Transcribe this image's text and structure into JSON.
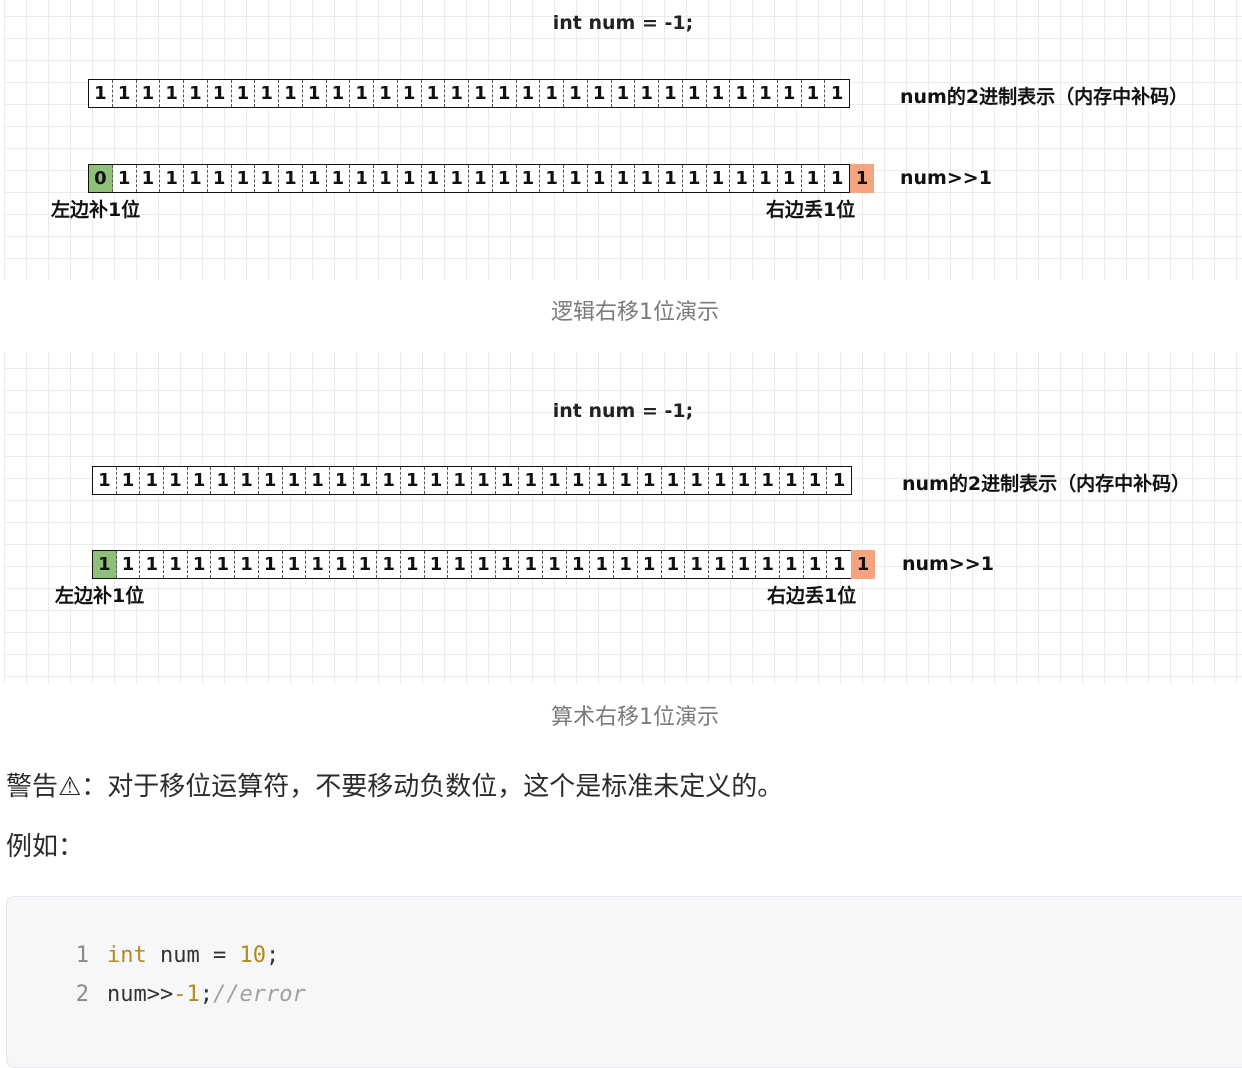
{
  "diagram1": {
    "title": "int num = -1;",
    "row1_bits": [
      "1",
      "1",
      "1",
      "1",
      "1",
      "1",
      "1",
      "1",
      "1",
      "1",
      "1",
      "1",
      "1",
      "1",
      "1",
      "1",
      "1",
      "1",
      "1",
      "1",
      "1",
      "1",
      "1",
      "1",
      "1",
      "1",
      "1",
      "1",
      "1",
      "1",
      "1",
      "1"
    ],
    "row1_label": "num的2进制表示（内存中补码）",
    "row2_bits": [
      "0",
      "1",
      "1",
      "1",
      "1",
      "1",
      "1",
      "1",
      "1",
      "1",
      "1",
      "1",
      "1",
      "1",
      "1",
      "1",
      "1",
      "1",
      "1",
      "1",
      "1",
      "1",
      "1",
      "1",
      "1",
      "1",
      "1",
      "1",
      "1",
      "1",
      "1",
      "1"
    ],
    "row2_out_bit": "1",
    "row2_label": "num>>1",
    "left_fill_label": "左边补1位",
    "right_drop_label": "右边丢1位",
    "fill_color": "#8fc07a",
    "drop_color": "#f4a57f"
  },
  "caption1": "逻辑右移1位演示",
  "diagram2": {
    "title": "int num = -1;",
    "row1_bits": [
      "1",
      "1",
      "1",
      "1",
      "1",
      "1",
      "1",
      "1",
      "1",
      "1",
      "1",
      "1",
      "1",
      "1",
      "1",
      "1",
      "1",
      "1",
      "1",
      "1",
      "1",
      "1",
      "1",
      "1",
      "1",
      "1",
      "1",
      "1",
      "1",
      "1",
      "1",
      "1"
    ],
    "row1_label": "num的2进制表示（内存中补码）",
    "row2_bits": [
      "1",
      "1",
      "1",
      "1",
      "1",
      "1",
      "1",
      "1",
      "1",
      "1",
      "1",
      "1",
      "1",
      "1",
      "1",
      "1",
      "1",
      "1",
      "1",
      "1",
      "1",
      "1",
      "1",
      "1",
      "1",
      "1",
      "1",
      "1",
      "1",
      "1",
      "1",
      "1"
    ],
    "row2_out_bit": "1",
    "row2_label": "num>>1",
    "left_fill_label": "左边补1位",
    "right_drop_label": "右边丢1位",
    "fill_color": "#8fc07a",
    "drop_color": "#f4a57f"
  },
  "caption2": "算术右移1位演示",
  "warning": "警告⚠：对于移位运算符，不要移动负数位，这个是标准未定义的。",
  "example": "例如：",
  "code": {
    "line1": {
      "num": "1",
      "kw": "int",
      "rest": " num = ",
      "val": "10",
      "end": ";"
    },
    "line2": {
      "num": "2",
      "plain": "num>>",
      "val": "-1",
      "end": ";",
      "comment": "//error"
    }
  }
}
